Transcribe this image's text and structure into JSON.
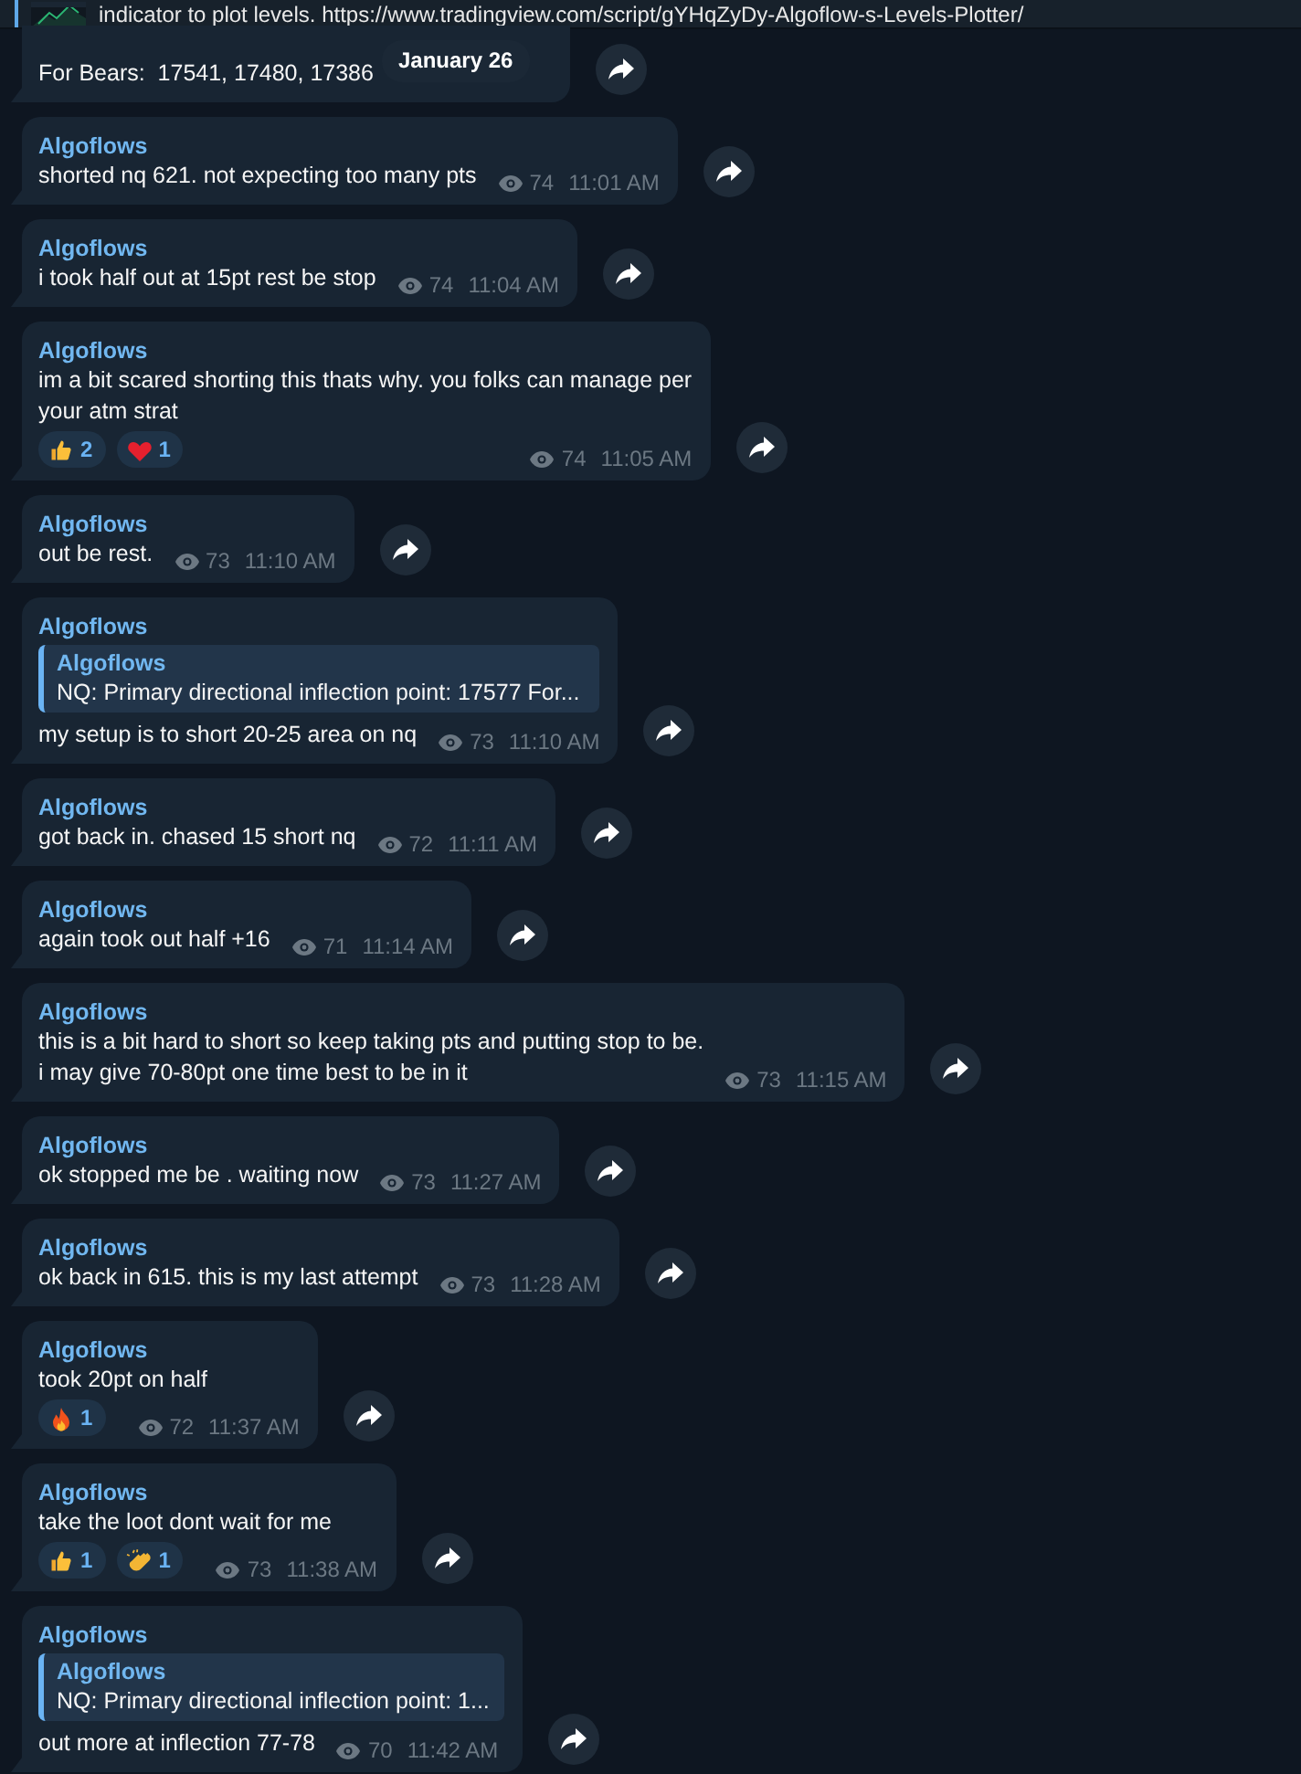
{
  "pinned": {
    "text": "indicator to plot levels. https://www.tradingview.com/script/gYHqZyDy-Algoflow-s-Levels-Plotter/"
  },
  "date_label": "January 26",
  "messages": [
    {
      "text": "For Bears:  17541, 17480, 17386"
    },
    {
      "sender": "Algoflows",
      "text": "shorted nq 621. not expecting too many pts",
      "views": "74",
      "time": "11:01 AM"
    },
    {
      "sender": "Algoflows",
      "text": "i took half out at 15pt rest be stop",
      "views": "74",
      "time": "11:04 AM"
    },
    {
      "sender": "Algoflows",
      "text": "im a bit scared shorting this thats why. you folks can manage per\nyour atm strat",
      "reactions": [
        {
          "kind": "thumbs-up",
          "count": "2"
        },
        {
          "kind": "heart",
          "count": "1"
        }
      ],
      "views": "74",
      "time": "11:05 AM"
    },
    {
      "sender": "Algoflows",
      "text": "out be rest.",
      "views": "73",
      "time": "11:10 AM"
    },
    {
      "sender": "Algoflows",
      "quote": {
        "sender": "Algoflows",
        "text": "NQ:  Primary directional inflection point: 17577  For..."
      },
      "text": "my setup is to short 20-25 area on nq",
      "views": "73",
      "time": "11:10 AM"
    },
    {
      "sender": "Algoflows",
      "text": "got back in. chased 15 short nq",
      "views": "72",
      "time": "11:11 AM"
    },
    {
      "sender": "Algoflows",
      "text": "again took out half +16",
      "views": "71",
      "time": "11:14 AM"
    },
    {
      "sender": "Algoflows",
      "text": "this is a bit hard to short so keep taking pts and putting stop to be.\ni may give 70-80pt one time best to be in it",
      "views": "73",
      "time": "11:15 AM"
    },
    {
      "sender": "Algoflows",
      "text": "ok stopped me be . waiting now",
      "views": "73",
      "time": "11:27 AM"
    },
    {
      "sender": "Algoflows",
      "text": "ok back in 615. this is my last attempt",
      "views": "73",
      "time": "11:28 AM"
    },
    {
      "sender": "Algoflows",
      "text": "took 20pt on half",
      "reactions": [
        {
          "kind": "fire",
          "count": "1"
        }
      ],
      "views": "72",
      "time": "11:37 AM"
    },
    {
      "sender": "Algoflows",
      "text": "take the loot dont wait for me",
      "reactions": [
        {
          "kind": "thumbs-up",
          "count": "1"
        },
        {
          "kind": "clap",
          "count": "1"
        }
      ],
      "views": "73",
      "time": "11:38 AM"
    },
    {
      "sender": "Algoflows",
      "quote": {
        "sender": "Algoflows",
        "text": "NQ:  Primary directional inflection point: 1..."
      },
      "text": "out more at inflection 77-78",
      "views": "70",
      "time": "11:42 AM"
    }
  ]
}
